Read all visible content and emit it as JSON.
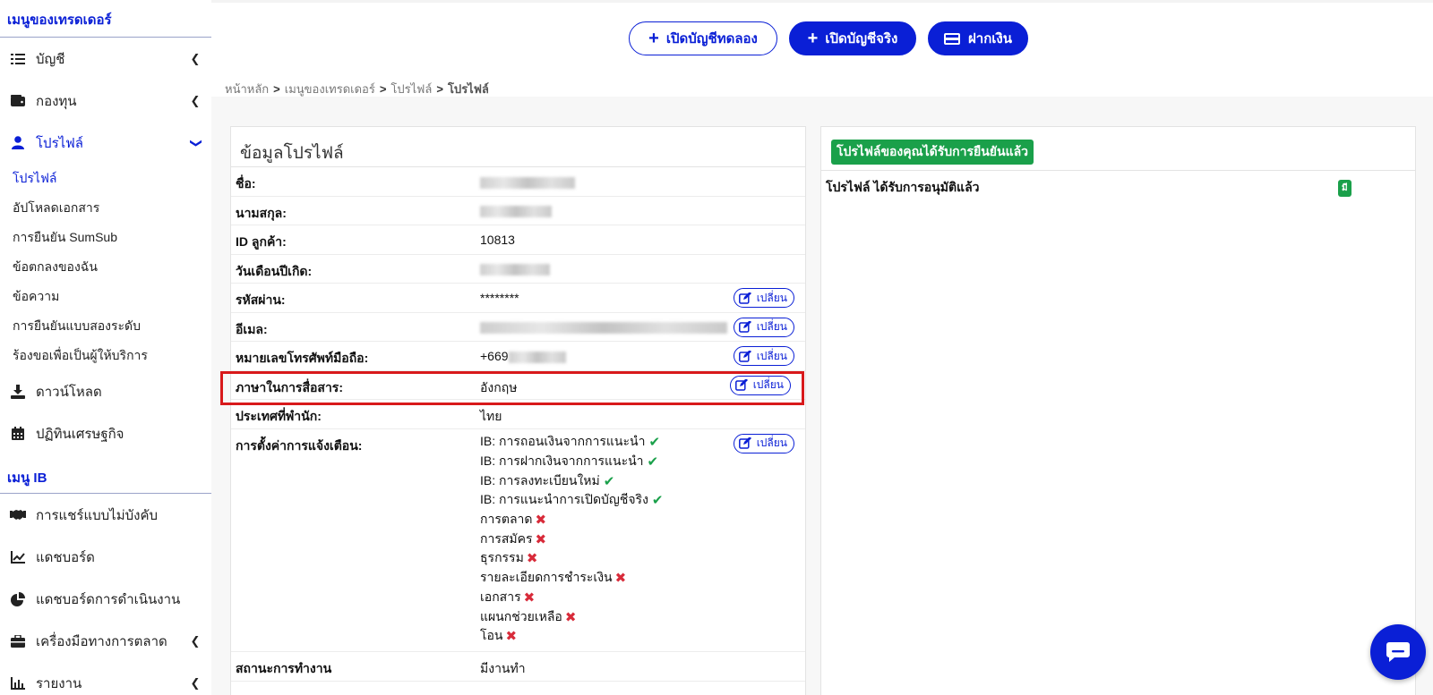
{
  "sidebar": {
    "trader_heading": "เมนูของเทรดเดอร์",
    "items": [
      {
        "label": "บัญชี",
        "icon": "list-icon"
      },
      {
        "label": "กองทุน",
        "icon": "wallet-icon"
      },
      {
        "label": "โปรไฟล์",
        "icon": "user-icon"
      }
    ],
    "profile_sub": [
      "โปรไฟล์",
      "อัปโหลดเอกสาร",
      "การยืนยัน SumSub",
      "ข้อตกลงของฉัน",
      "ข้อความ",
      "การยืนยันแบบสองระดับ",
      "ร้องขอเพื่อเป็นผู้ให้บริการ"
    ],
    "items2": [
      {
        "label": "ดาวน์โหลด",
        "icon": "download-icon"
      },
      {
        "label": "ปฏิทินเศรษฐกิจ",
        "icon": "calendar-icon"
      }
    ],
    "ib_heading": "เมนู IB",
    "ib_items": [
      {
        "label": "การแชร์แบบไม่บังคับ",
        "icon": "handshake-icon"
      },
      {
        "label": "แดชบอร์ด",
        "icon": "chart-line-icon"
      },
      {
        "label": "แดชบอร์ดการดำเนินงาน",
        "icon": "pie-chart-icon"
      },
      {
        "label": "เครื่องมือทางการตลาด",
        "icon": "briefcase-icon"
      },
      {
        "label": "รายงาน",
        "icon": "bar-chart-icon"
      }
    ]
  },
  "topbar": {
    "demo_label": "เปิดบัญชีทดลอง",
    "live_label": "เปิดบัญชีจริง",
    "deposit_label": "ฝากเงิน"
  },
  "breadcrumb": [
    "หน้าหลัก",
    "เมนูของเทรดเดอร์",
    "โปรไฟล์",
    "โปรไฟล์"
  ],
  "profile": {
    "title": "ข้อมูลโปรไฟล์",
    "change_label": "เปลี่ยน",
    "rows": {
      "first_name": {
        "label": "ชื่อ:"
      },
      "last_name": {
        "label": "นามสกุล:"
      },
      "client_id": {
        "label": "ID ลูกค้า:",
        "value": "10813"
      },
      "birth_date": {
        "label": "วันเดือนปีเกิด:"
      },
      "password": {
        "label": "รหัสผ่าน:",
        "value": "********"
      },
      "email": {
        "label": "อีเมล:"
      },
      "phone": {
        "label": "หมายเลขโทรศัพท์มือถือ:",
        "value": "+669"
      },
      "language": {
        "label": "ภาษาในการสื่อสาร:",
        "value": "อังกฤษ"
      },
      "country": {
        "label": "ประเทศที่พำนัก:",
        "value": "ไทย"
      },
      "notifications": {
        "label": "การตั้งค่าการแจ้งเตือน:"
      },
      "employment": {
        "label": "สถานะการทำงาน",
        "value": "มีงานทำ"
      }
    },
    "notification_items": [
      {
        "text": "IB: การถอนเงินจากการแนะนำ",
        "enabled": true
      },
      {
        "text": "IB: การฝากเงินจากการแนะนำ",
        "enabled": true
      },
      {
        "text": "IB: การลงทะเบียนใหม่",
        "enabled": true
      },
      {
        "text": "IB: การแนะนำการเปิดบัญชีจริง",
        "enabled": true
      },
      {
        "text": "การตลาด",
        "enabled": false
      },
      {
        "text": "การสมัคร",
        "enabled": false
      },
      {
        "text": "ธุรกรรม",
        "enabled": false
      },
      {
        "text": "รายละเอียดการชำระเงิน",
        "enabled": false
      },
      {
        "text": "เอกสาร",
        "enabled": false
      },
      {
        "text": "แผนกช่วยเหลือ",
        "enabled": false
      },
      {
        "text": "โอน",
        "enabled": false
      }
    ]
  },
  "verification": {
    "badge": "โปรไฟล์ของคุณได้รับการยืนยันแล้ว",
    "text": "โปรไฟล์ ได้รับการอนุมัติแล้ว",
    "yes": "มี"
  },
  "colors": {
    "accent": "#0a1fd6",
    "success": "#1aa04a",
    "danger": "#d82b3a",
    "highlight": "#d8191b"
  }
}
